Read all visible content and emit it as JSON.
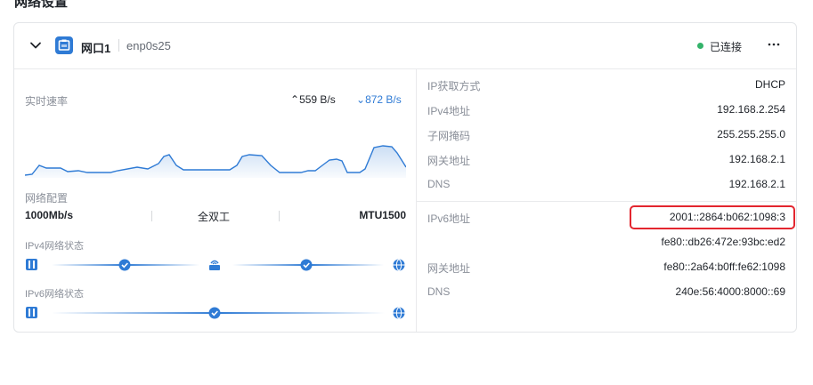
{
  "page": {
    "heading": "网络设置"
  },
  "header": {
    "port_name": "网口1",
    "interface": "enp0s25",
    "status": "已连接",
    "colors": {
      "status": "#34b36a",
      "accent": "#2f7bd5"
    }
  },
  "speed": {
    "title": "实时速率",
    "upload": "559 B/s",
    "download": "872 B/s"
  },
  "config": {
    "title": "网络配置",
    "link_speed": "1000Mb/s",
    "duplex": "全双工",
    "mtu": "MTU1500"
  },
  "ipv4_status": {
    "title": "IPv4网络状态"
  },
  "ipv6_status": {
    "title": "IPv6网络状态"
  },
  "ipv4": {
    "method_label": "IP获取方式",
    "method": "DHCP",
    "addr_label": "IPv4地址",
    "addr": "192.168.2.254",
    "mask_label": "子网掩码",
    "mask": "255.255.255.0",
    "gateway_label": "网关地址",
    "gateway": "192.168.2.1",
    "dns_label": "DNS",
    "dns": "192.168.2.1"
  },
  "ipv6": {
    "addr_label": "IPv6地址",
    "addr1": "2001::2864:b062:1098:3",
    "addr2": "fe80::db26:472e:93bc:ed2",
    "gateway_label": "网关地址",
    "gateway": "fe80::2a64:b0ff:fe62:1098",
    "dns_label": "DNS",
    "dns": "240e:56:4000:8000::69"
  }
}
